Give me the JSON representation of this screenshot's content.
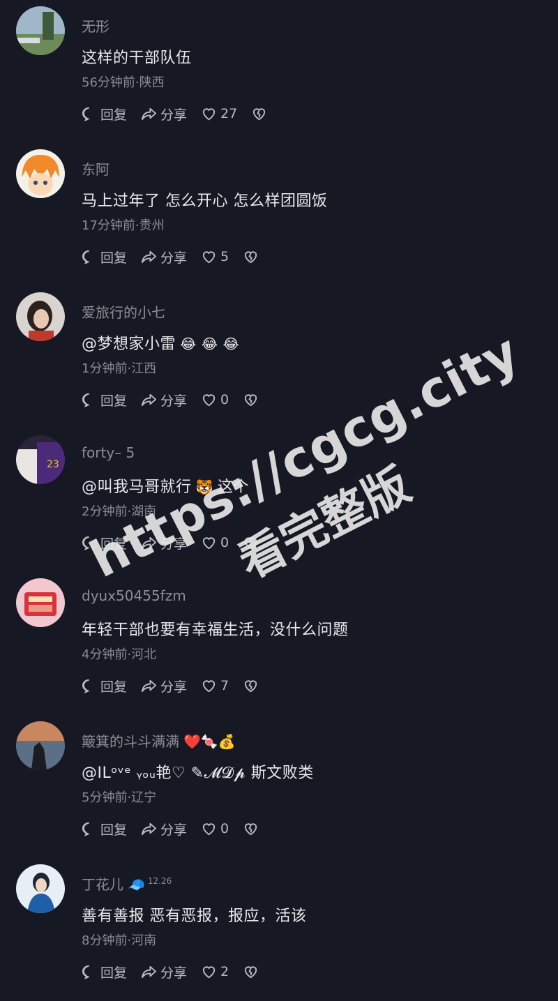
{
  "labels": {
    "reply": "回复",
    "share": "分享"
  },
  "comments": [
    {
      "username": "无形",
      "text": "这样的干部队伍",
      "meta": "56分钟前·陕西",
      "likes": "27"
    },
    {
      "username": "东阿",
      "text": "马上过年了 怎么开心 怎么样团圆饭",
      "meta": "17分钟前·贵州",
      "likes": "5"
    },
    {
      "username": "爱旅行的小七",
      "text": "@梦想家小雷",
      "emoji": "😂 😂 😂",
      "meta": "1分钟前·江西",
      "likes": "0"
    },
    {
      "username": "forty– 5",
      "text": "@叫我马哥就行",
      "emoji": "🐯",
      "text_tail": "这个",
      "meta": "2分钟前·湖南",
      "likes": "0"
    },
    {
      "username": "dyux50455fzm",
      "text": "年轻干部也要有幸福生活，没什么问题",
      "meta": "4分钟前·河北",
      "likes": "7"
    },
    {
      "username": "簸箕的斗斗满满",
      "username_emoji": "❤️🍬💰",
      "text": "@ILᵒᵛᵉ ᵧₒᵤ艳♡ ✎𝓜𝓓𝓹 斯文败类",
      "meta": "5分钟前·辽宁",
      "likes": "0"
    },
    {
      "username": "丁花儿",
      "badge": "🧢",
      "badge_num": "12.26",
      "text": "善有善报 恶有恶报，报应，活该",
      "meta": "8分钟前·河南",
      "likes": "2"
    }
  ],
  "watermark": {
    "line1": "https://cgcg.city",
    "line2": "看完整版"
  },
  "colors": {
    "background": "#161823",
    "muted": "#8a8b91",
    "text": "#eaeaec"
  }
}
